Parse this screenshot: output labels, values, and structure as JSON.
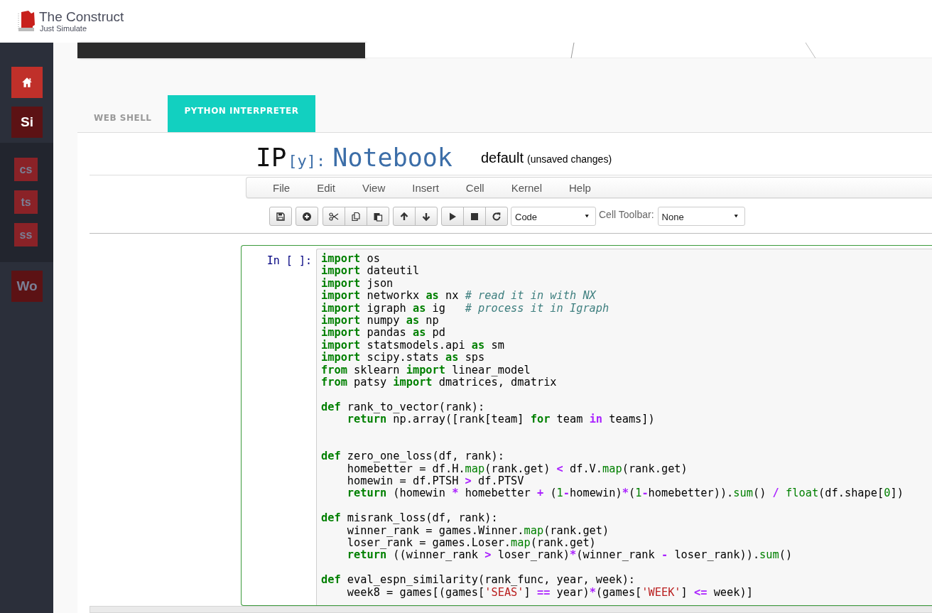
{
  "header": {
    "title": "The Construct",
    "subtitle": "Just Simulate"
  },
  "sidebar": {
    "items": [
      {
        "kind": "home",
        "selected": false
      },
      {
        "kind": "main",
        "label": "Si",
        "selected": true
      },
      {
        "kind": "sub",
        "label": "cs",
        "selected": false
      },
      {
        "kind": "sub",
        "label": "ts",
        "selected": false
      },
      {
        "kind": "sub",
        "label": "ss",
        "selected": false
      },
      {
        "kind": "main",
        "label": "Wo",
        "selected": false
      }
    ]
  },
  "tabs": [
    {
      "label": "WEB SHELL",
      "selected": false
    },
    {
      "label": "PYTHON INTERPRETER",
      "selected": true
    }
  ],
  "notebook": {
    "logo": {
      "ip": "IP",
      "bracket": "[y]:",
      "name": "Notebook"
    },
    "name": "default",
    "status": "(unsaved changes)",
    "menu": [
      "File",
      "Edit",
      "View",
      "Insert",
      "Cell",
      "Kernel",
      "Help"
    ],
    "cell_type": "Code",
    "cell_toolbar_label": "Cell Toolbar:",
    "cell_toolbar": "None",
    "cell": {
      "prompt": "In [ ]:",
      "lines": [
        {
          "kind": "code",
          "tokens": [
            {
              "kind": "keyword",
              "text": "import"
            },
            {
              "kind": "plain",
              "text": " os"
            }
          ]
        },
        {
          "kind": "code",
          "tokens": [
            {
              "kind": "keyword",
              "text": "import"
            },
            {
              "kind": "plain",
              "text": " dateutil"
            }
          ]
        },
        {
          "kind": "code",
          "tokens": [
            {
              "kind": "keyword",
              "text": "import"
            },
            {
              "kind": "plain",
              "text": " json"
            }
          ]
        },
        {
          "kind": "code",
          "tokens": [
            {
              "kind": "keyword",
              "text": "import"
            },
            {
              "kind": "plain",
              "text": " networkx "
            },
            {
              "kind": "keyword",
              "text": "as"
            },
            {
              "kind": "plain",
              "text": " nx "
            },
            {
              "kind": "comment",
              "text": "# read it in with NX"
            }
          ]
        },
        {
          "kind": "code",
          "tokens": [
            {
              "kind": "keyword",
              "text": "import"
            },
            {
              "kind": "plain",
              "text": " igraph "
            },
            {
              "kind": "keyword",
              "text": "as"
            },
            {
              "kind": "plain",
              "text": " ig   "
            },
            {
              "kind": "comment",
              "text": "# process it in Igraph"
            }
          ]
        },
        {
          "kind": "code",
          "tokens": [
            {
              "kind": "keyword",
              "text": "import"
            },
            {
              "kind": "plain",
              "text": " numpy "
            },
            {
              "kind": "keyword",
              "text": "as"
            },
            {
              "kind": "plain",
              "text": " np"
            }
          ]
        },
        {
          "kind": "code",
          "tokens": [
            {
              "kind": "keyword",
              "text": "import"
            },
            {
              "kind": "plain",
              "text": " pandas "
            },
            {
              "kind": "keyword",
              "text": "as"
            },
            {
              "kind": "plain",
              "text": " pd"
            }
          ]
        },
        {
          "kind": "code",
          "tokens": [
            {
              "kind": "keyword",
              "text": "import"
            },
            {
              "kind": "plain",
              "text": " statsmodels.api "
            },
            {
              "kind": "keyword",
              "text": "as"
            },
            {
              "kind": "plain",
              "text": " sm"
            }
          ]
        },
        {
          "kind": "code",
          "tokens": [
            {
              "kind": "keyword",
              "text": "import"
            },
            {
              "kind": "plain",
              "text": " scipy.stats "
            },
            {
              "kind": "keyword",
              "text": "as"
            },
            {
              "kind": "plain",
              "text": " sps"
            }
          ]
        },
        {
          "kind": "code",
          "tokens": [
            {
              "kind": "keyword",
              "text": "from"
            },
            {
              "kind": "plain",
              "text": " sklearn "
            },
            {
              "kind": "keyword",
              "text": "import"
            },
            {
              "kind": "plain",
              "text": " linear_model"
            }
          ]
        },
        {
          "kind": "code",
          "tokens": [
            {
              "kind": "keyword",
              "text": "from"
            },
            {
              "kind": "plain",
              "text": " patsy "
            },
            {
              "kind": "keyword",
              "text": "import"
            },
            {
              "kind": "plain",
              "text": " dmatrices, dmatrix"
            }
          ]
        },
        {
          "kind": "blank"
        },
        {
          "kind": "code",
          "tokens": [
            {
              "kind": "keyword",
              "text": "def"
            },
            {
              "kind": "plain",
              "text": " rank_to_vector(rank):"
            }
          ]
        },
        {
          "kind": "code",
          "tokens": [
            {
              "kind": "keyword",
              "text": "    return"
            },
            {
              "kind": "plain",
              "text": " np.array([rank[team] "
            },
            {
              "kind": "keyword",
              "text": "for"
            },
            {
              "kind": "plain",
              "text": " team "
            },
            {
              "kind": "operator",
              "text": "in"
            },
            {
              "kind": "plain",
              "text": " teams])"
            }
          ]
        },
        {
          "kind": "blank"
        },
        {
          "kind": "blank"
        },
        {
          "kind": "code",
          "tokens": [
            {
              "kind": "keyword",
              "text": "def"
            },
            {
              "kind": "plain",
              "text": " zero_one_loss(df, rank):"
            }
          ]
        },
        {
          "kind": "code",
          "tokens": [
            {
              "kind": "plain",
              "text": "    homebetter = df.H."
            },
            {
              "kind": "builtin",
              "text": "map"
            },
            {
              "kind": "plain",
              "text": "(rank.get) "
            },
            {
              "kind": "operator",
              "text": "<"
            },
            {
              "kind": "plain",
              "text": " df.V."
            },
            {
              "kind": "builtin",
              "text": "map"
            },
            {
              "kind": "plain",
              "text": "(rank.get)"
            }
          ]
        },
        {
          "kind": "code",
          "tokens": [
            {
              "kind": "plain",
              "text": "    homewin = df.PTSH "
            },
            {
              "kind": "operator",
              "text": ">"
            },
            {
              "kind": "plain",
              "text": " df.PTSV"
            }
          ]
        },
        {
          "kind": "code",
          "tokens": [
            {
              "kind": "keyword",
              "text": "    return"
            },
            {
              "kind": "plain",
              "text": " (homewin "
            },
            {
              "kind": "operator",
              "text": "*"
            },
            {
              "kind": "plain",
              "text": " homebetter "
            },
            {
              "kind": "operator",
              "text": "+"
            },
            {
              "kind": "plain",
              "text": " ("
            },
            {
              "kind": "number",
              "text": "1"
            },
            {
              "kind": "operator",
              "text": "-"
            },
            {
              "kind": "plain",
              "text": "homewin)"
            },
            {
              "kind": "operator",
              "text": "*"
            },
            {
              "kind": "plain",
              "text": "("
            },
            {
              "kind": "number",
              "text": "1"
            },
            {
              "kind": "operator",
              "text": "-"
            },
            {
              "kind": "plain",
              "text": "homebetter))."
            },
            {
              "kind": "builtin",
              "text": "sum"
            },
            {
              "kind": "plain",
              "text": "() "
            },
            {
              "kind": "operator",
              "text": "/"
            },
            {
              "kind": "builtin",
              "text": " float"
            },
            {
              "kind": "plain",
              "text": "(df.shape["
            },
            {
              "kind": "number",
              "text": "0"
            },
            {
              "kind": "plain",
              "text": "])"
            }
          ]
        },
        {
          "kind": "blank"
        },
        {
          "kind": "code",
          "tokens": [
            {
              "kind": "keyword",
              "text": "def"
            },
            {
              "kind": "plain",
              "text": " misrank_loss(df, rank):"
            }
          ]
        },
        {
          "kind": "code",
          "tokens": [
            {
              "kind": "plain",
              "text": "    winner_rank = games.Winner."
            },
            {
              "kind": "builtin",
              "text": "map"
            },
            {
              "kind": "plain",
              "text": "(rank.get)"
            }
          ]
        },
        {
          "kind": "code",
          "tokens": [
            {
              "kind": "plain",
              "text": "    loser_rank = games.Loser."
            },
            {
              "kind": "builtin",
              "text": "map"
            },
            {
              "kind": "plain",
              "text": "(rank.get)"
            }
          ]
        },
        {
          "kind": "code",
          "tokens": [
            {
              "kind": "keyword",
              "text": "    return"
            },
            {
              "kind": "plain",
              "text": " ((winner_rank "
            },
            {
              "kind": "operator",
              "text": ">"
            },
            {
              "kind": "plain",
              "text": " loser_rank)"
            },
            {
              "kind": "operator",
              "text": "*"
            },
            {
              "kind": "plain",
              "text": "(winner_rank "
            },
            {
              "kind": "operator",
              "text": "-"
            },
            {
              "kind": "plain",
              "text": " loser_rank))."
            },
            {
              "kind": "builtin",
              "text": "sum"
            },
            {
              "kind": "plain",
              "text": "()"
            }
          ]
        },
        {
          "kind": "blank"
        },
        {
          "kind": "code",
          "tokens": [
            {
              "kind": "keyword",
              "text": "def"
            },
            {
              "kind": "plain",
              "text": " eval_espn_similarity(rank_func, year, week):"
            }
          ]
        },
        {
          "kind": "code",
          "tokens": [
            {
              "kind": "plain",
              "text": "    week8 = games[(games["
            },
            {
              "kind": "string",
              "text": "'SEAS'"
            },
            {
              "kind": "plain",
              "text": "] "
            },
            {
              "kind": "operator",
              "text": "=="
            },
            {
              "kind": "plain",
              "text": " year)"
            },
            {
              "kind": "operator",
              "text": "*"
            },
            {
              "kind": "plain",
              "text": "(games["
            },
            {
              "kind": "string",
              "text": "'WEEK'"
            },
            {
              "kind": "plain",
              "text": "] "
            },
            {
              "kind": "operator",
              "text": "<="
            },
            {
              "kind": "plain",
              "text": " week)]"
            }
          ]
        }
      ]
    }
  }
}
